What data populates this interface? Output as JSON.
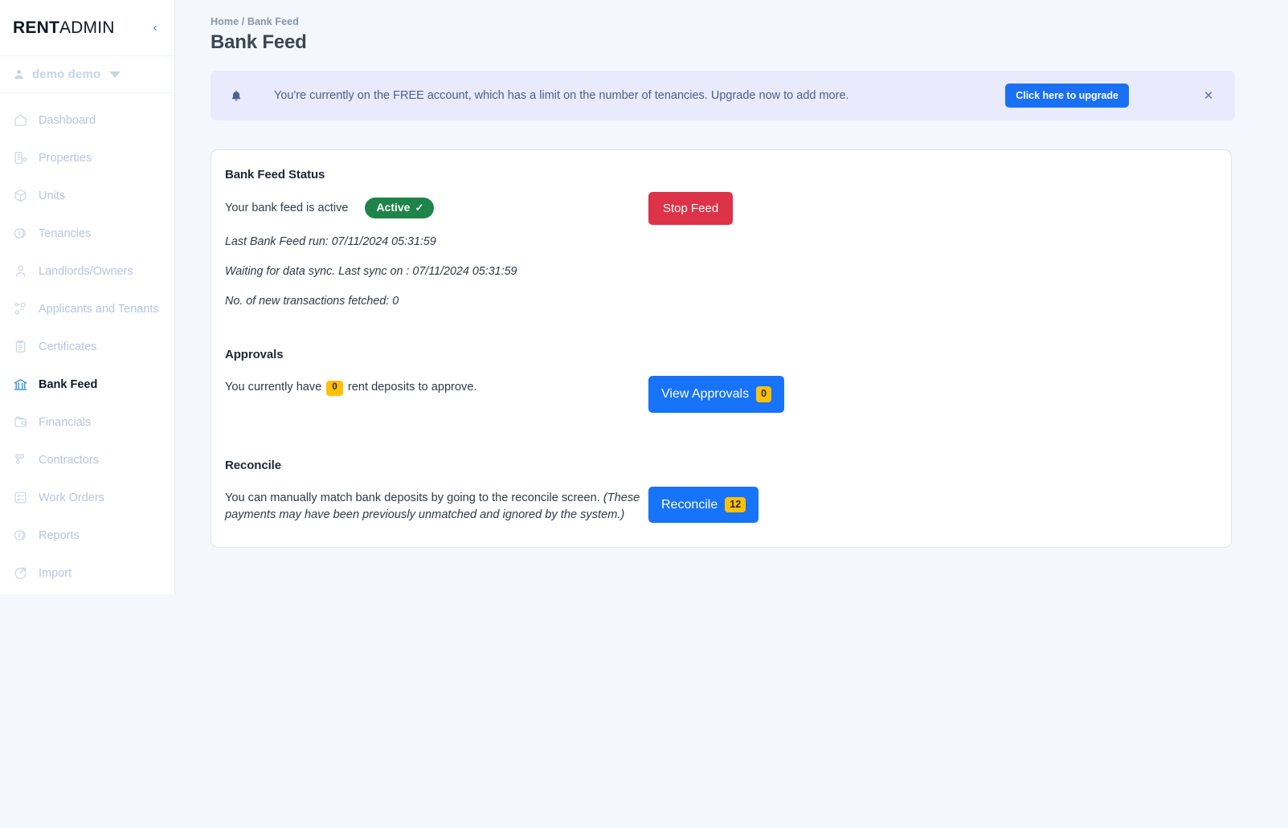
{
  "brand": {
    "bold": "RENT",
    "light": "ADMIN",
    "collapse_icon": "chevron-left-icon"
  },
  "sidebar": {
    "user": {
      "name": "demo demo",
      "avatar_icon": "person-icon",
      "caret_icon": "caret-down-icon"
    },
    "items": [
      {
        "label": "Dashboard",
        "icon": "home-icon",
        "active": false
      },
      {
        "label": "Properties",
        "icon": "building-icon",
        "active": false
      },
      {
        "label": "Units",
        "icon": "cube-icon",
        "active": false
      },
      {
        "label": "Tenancies",
        "icon": "coins-icon",
        "active": false
      },
      {
        "label": "Landlords/Owners",
        "icon": "user-icon",
        "active": false
      },
      {
        "label": "Applicants and Tenants",
        "icon": "users-group-icon",
        "active": false
      },
      {
        "label": "Certificates",
        "icon": "clipboard-icon",
        "active": false
      },
      {
        "label": "Bank Feed",
        "icon": "bank-icon",
        "active": true
      },
      {
        "label": "Financials",
        "icon": "wallet-icon",
        "active": false
      },
      {
        "label": "Contractors",
        "icon": "tools-icon",
        "active": false
      },
      {
        "label": "Work Orders",
        "icon": "checklist-icon",
        "active": false
      },
      {
        "label": "Reports",
        "icon": "chart-icon",
        "active": false
      },
      {
        "label": "Import",
        "icon": "import-arrow-icon",
        "active": false
      }
    ]
  },
  "header": {
    "breadcrumb": "Home / Bank Feed",
    "title": "Bank Feed"
  },
  "banner": {
    "bell_icon": "bell-icon",
    "message": "You're currently on the FREE account, which has a limit on the number of tenancies. Upgrade now to add more.",
    "upgrade_label": "Click here to upgrade",
    "close_icon": "close-icon",
    "close_label": "×"
  },
  "status_section": {
    "title": "Bank Feed Status",
    "status_text": "Your bank feed is active",
    "badge_label": "Active",
    "badge_tick": "✓",
    "last_run": "Last Bank Feed run: 07/11/2024 05:31:59",
    "last_sync": "Waiting for data sync. Last sync on : 07/11/2024 05:31:59",
    "transactions_fetched": "No. of new transactions fetched: 0",
    "stop_button": "Stop Feed"
  },
  "approvals_section": {
    "title": "Approvals",
    "text_before": "You currently have",
    "count": "0",
    "text_after": "rent deposits to approve.",
    "button_label": "View Approvals",
    "button_count": "0"
  },
  "reconcile_section": {
    "title": "Reconcile",
    "line1": "You can manually match bank deposits by going to the reconcile screen.",
    "line2": "(These payments may have been previously unmatched and ignored by the system.)",
    "button_label": "Reconcile",
    "button_count": "12"
  },
  "colors": {
    "accent_blue": "#1773f7",
    "danger_red": "#dd3349",
    "success_green": "#1e8449",
    "badge_amber": "#ffc107",
    "page_bg": "#f4f7fd",
    "banner_bg": "#e9ebfc"
  }
}
